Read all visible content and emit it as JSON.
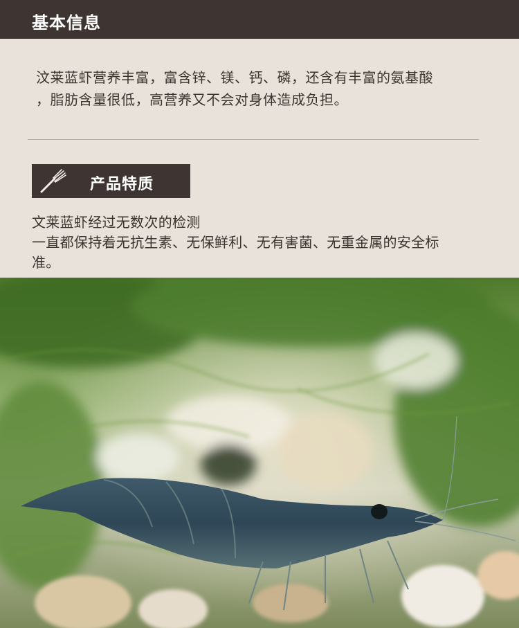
{
  "header": {
    "title": "基本信息"
  },
  "intro": {
    "lines": [
      "汶莱蓝虾营养丰富，富含锌、镁、钙、磷，还含有丰富的氨基酸",
      "，脂肪含量很低，高营养又不会对身体造成负担。"
    ]
  },
  "quality": {
    "title": "产品特质",
    "icon": "fork-icon",
    "lines": [
      "文莱蓝虾经过无数次的检测",
      "一直都保持着无抗生素、无保鲜利、无有害菌、无重金属的安全标",
      "准。"
    ]
  },
  "photo": {
    "subject": "blue-shrimp-on-moss-photo"
  },
  "colors": {
    "header_bg": "#3e3532",
    "page_bg": "#e9e2da",
    "text": "#3a3330"
  }
}
